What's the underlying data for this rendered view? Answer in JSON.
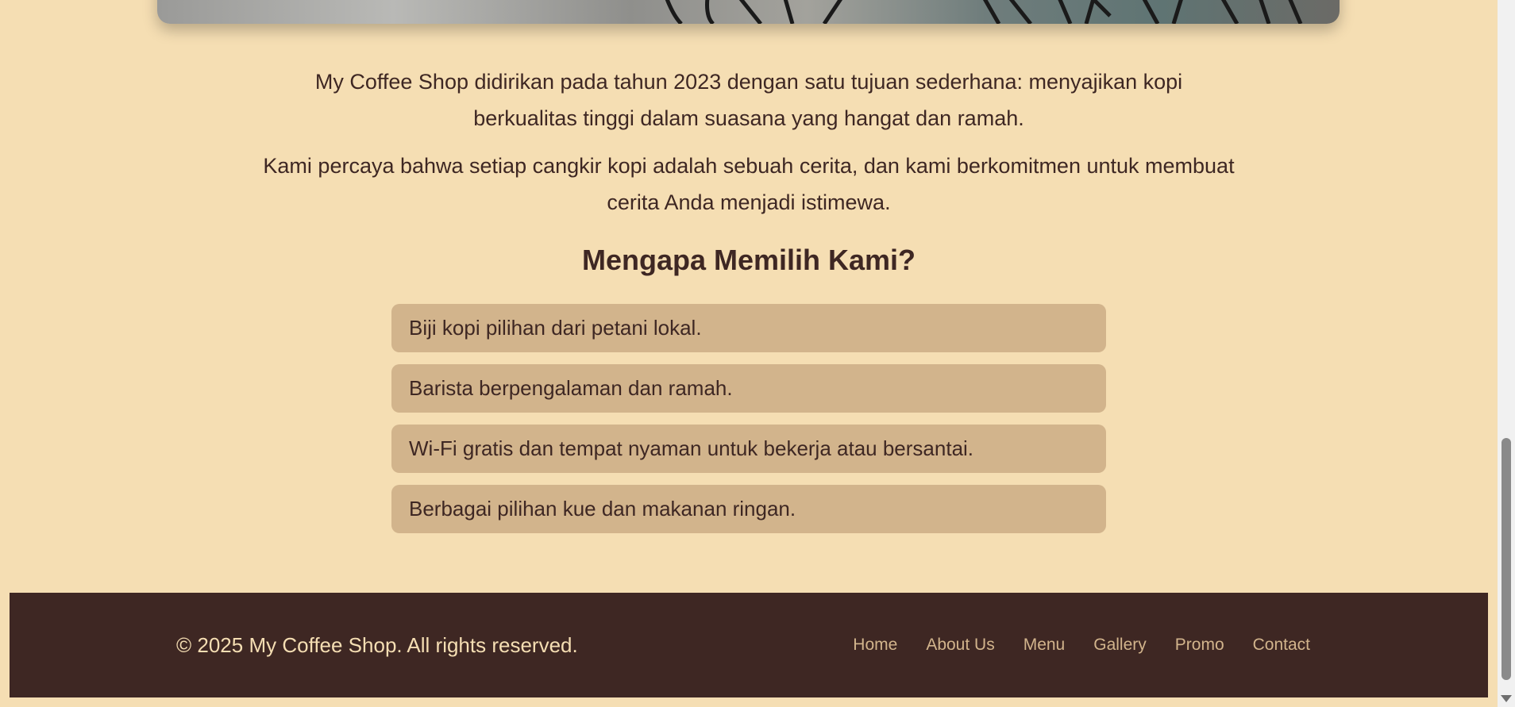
{
  "about": {
    "paragraphs": [
      "My Coffee Shop didirikan pada tahun 2023 dengan satu tujuan sederhana: menyajikan kopi berkualitas tinggi dalam suasana yang hangat dan ramah.",
      "Kami percaya bahwa setiap cangkir kopi adalah sebuah cerita, dan kami berkomitmen untuk membuat cerita Anda menjadi istimewa."
    ]
  },
  "why": {
    "title": "Mengapa Memilih Kami?",
    "reasons": [
      "Biji kopi pilihan dari petani lokal.",
      "Barista berpengalaman dan ramah.",
      "Wi-Fi gratis dan tempat nyaman untuk bekerja atau bersantai.",
      "Berbagai pilihan kue dan makanan ringan."
    ]
  },
  "footer": {
    "copyright": "© 2025 My Coffee Shop. All rights reserved.",
    "nav": [
      "Home",
      "About Us",
      "Menu",
      "Gallery",
      "Promo",
      "Contact"
    ]
  },
  "colors": {
    "background": "#f5deb3",
    "text": "#3e2723",
    "card": "#d2b48c",
    "footer": "#3e2723",
    "footer_link": "#d2b48c",
    "footer_text": "#f5deb3"
  },
  "icons": [
    "scroll-down-arrow-icon"
  ]
}
